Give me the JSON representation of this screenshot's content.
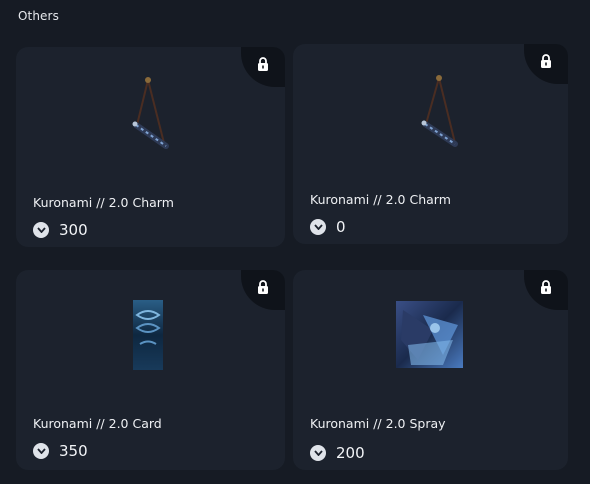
{
  "section": {
    "title": "Others"
  },
  "items": [
    {
      "name": "Kuronami // 2.0 Charm",
      "price": "300",
      "locked": true,
      "icon": "charm-image"
    },
    {
      "name": "Kuronami // 2.0 Charm",
      "price": "0",
      "locked": true,
      "icon": "charm-image"
    },
    {
      "name": "Kuronami // 2.0 Card",
      "price": "350",
      "locked": true,
      "icon": "card-image"
    },
    {
      "name": "Kuronami // 2.0 Spray",
      "price": "200",
      "locked": true,
      "icon": "spray-image"
    }
  ],
  "colors": {
    "background": "#161b24",
    "card": "#1c222d",
    "lock_corner": "#0f131a",
    "text": "#eef0f3"
  }
}
